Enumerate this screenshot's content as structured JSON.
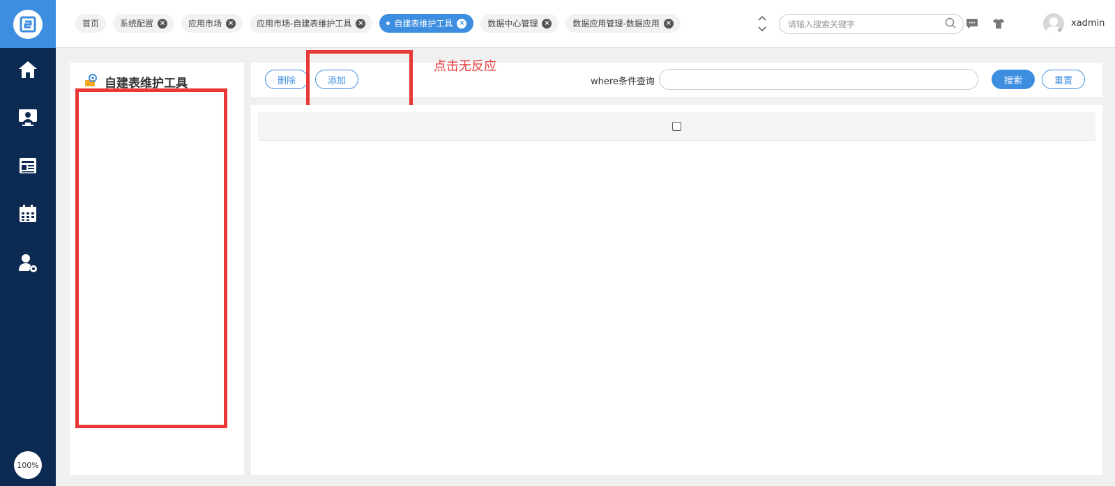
{
  "sidebar": {
    "logo_icon": "app-logo",
    "nav": [
      {
        "name": "home",
        "icon": "home-icon"
      },
      {
        "name": "monitor",
        "icon": "monitor-user-icon"
      },
      {
        "name": "report",
        "icon": "newspaper-icon"
      },
      {
        "name": "calendar",
        "icon": "calendar-icon"
      },
      {
        "name": "user-settings",
        "icon": "user-gear-icon"
      }
    ],
    "zoom": "100%"
  },
  "tabs": [
    {
      "label": "首页",
      "closable": false,
      "active": false
    },
    {
      "label": "系统配置",
      "closable": true,
      "active": false
    },
    {
      "label": "应用市场",
      "closable": true,
      "active": false
    },
    {
      "label": "应用市场-自建表维护工具",
      "closable": true,
      "active": false
    },
    {
      "label": "自建表维护工具",
      "closable": true,
      "active": true
    },
    {
      "label": "数据中心管理",
      "closable": true,
      "active": false
    },
    {
      "label": "数据应用管理-数据应用",
      "closable": true,
      "active": false
    }
  ],
  "header": {
    "search_placeholder": "请输入搜索关键字",
    "username": "xadmin",
    "accent_color": "#3d8ee0"
  },
  "tree_panel": {
    "title": "自建表维护工具"
  },
  "toolbar": {
    "delete_label": "删除",
    "add_label": "添加",
    "where_label": "where条件查询",
    "where_value": "",
    "search_label": "搜索",
    "reset_label": "重置"
  },
  "annotation": {
    "text": "点击无反应",
    "color": "#e83838"
  }
}
